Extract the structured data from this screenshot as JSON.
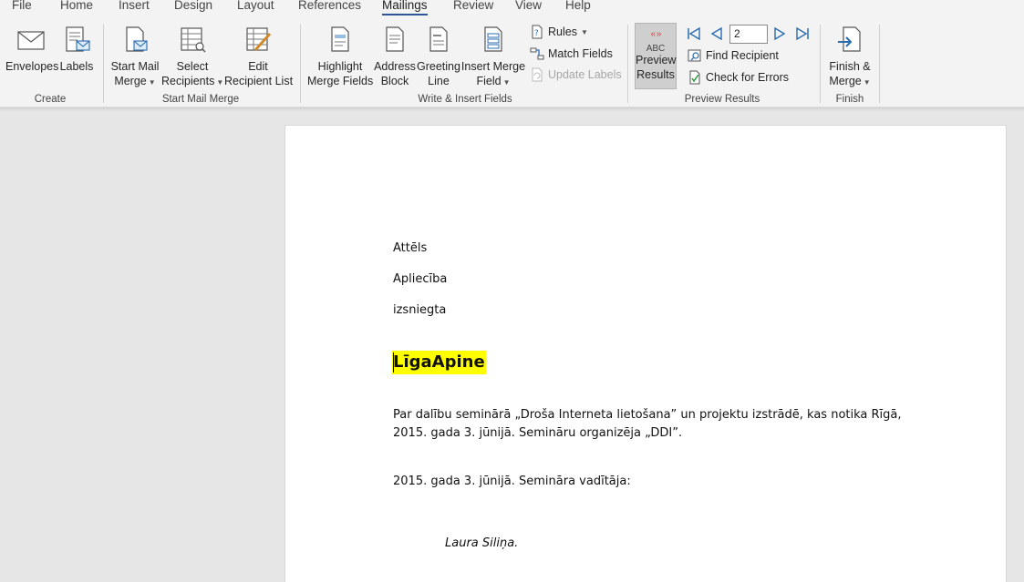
{
  "menu": {
    "tabs": [
      "File",
      "Home",
      "Insert",
      "Design",
      "Layout",
      "References",
      "Mailings",
      "Review",
      "View",
      "Help"
    ],
    "active_tab": "Mailings"
  },
  "ribbon": {
    "create": {
      "label": "Create",
      "envelopes": "Envelopes",
      "labels": "Labels"
    },
    "start_mail_merge": {
      "label": "Start Mail Merge",
      "start_line1": "Start Mail",
      "start_line2": "Merge",
      "select_line1": "Select",
      "select_line2": "Recipients",
      "edit_line1": "Edit",
      "edit_line2": "Recipient List"
    },
    "write_insert": {
      "label": "Write & Insert Fields",
      "highlight_line1": "Highlight",
      "highlight_line2": "Merge Fields",
      "address_line1": "Address",
      "address_line2": "Block",
      "greeting_line1": "Greeting",
      "greeting_line2": "Line",
      "insert_line1": "Insert Merge",
      "insert_line2": "Field",
      "rules": "Rules",
      "match_fields": "Match Fields",
      "update_labels": "Update Labels"
    },
    "preview_results": {
      "label": "Preview Results",
      "abc": "ABC",
      "preview_line1": "Preview",
      "preview_line2": "Results",
      "record_value": "2",
      "find_recipient": "Find Recipient",
      "check_errors": "Check for Errors"
    },
    "finish": {
      "label": "Finish",
      "finish_line1": "Finish &",
      "finish_line2": "Merge"
    }
  },
  "document": {
    "line1": "Attēls",
    "line2": "Apliecība",
    "line3": "izsniegta",
    "recipient_name": "LīgaApine",
    "paragraph": "Par dalību seminārā „Droša Interneta lietošana” un projektu izstrādē, kas notika Rīgā, 2015. gada 3. jūnijā. Semināru organizēja „DDI”.",
    "date_line": "2015. gada 3. jūnijā. Semināra vadītāja:",
    "signer": "Laura Siliņa."
  },
  "colors": {
    "accent": "#2b579a",
    "highlight": "#ffff00",
    "pressed": "#cfcfcf"
  },
  "icons": [
    "envelope-icon",
    "labels-icon",
    "start-mail-merge-icon",
    "select-recipients-icon",
    "edit-recipient-list-icon",
    "highlight-merge-fields-icon",
    "address-block-icon",
    "greeting-line-icon",
    "insert-merge-field-icon",
    "rules-icon",
    "match-fields-icon",
    "update-labels-icon",
    "first-record-icon",
    "previous-record-icon",
    "next-record-icon",
    "last-record-icon",
    "find-recipient-icon",
    "check-errors-icon",
    "finish-merge-icon"
  ]
}
